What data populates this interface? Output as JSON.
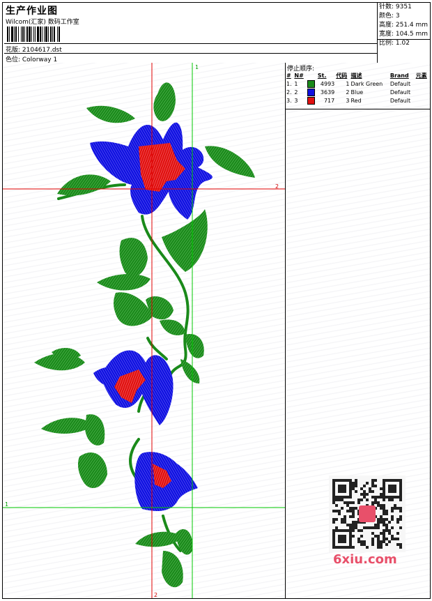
{
  "header": {
    "title": "生产作业图",
    "subtitle": "Wilcom(汇家) 数码工作室",
    "design_label": "花版: 2104617.dst",
    "colorway_label": "色位:  Colorway 1"
  },
  "stats": [
    "针数: 9351",
    "颜色: 3",
    "高度: 251.4 mm",
    "宽度: 104.5 mm",
    "比例: 1.02"
  ],
  "stop_sequence": {
    "title": "停止顺序:",
    "columns": [
      "#",
      "N#",
      "St.",
      "代码",
      "描述",
      "Brand",
      "元素"
    ],
    "rows": [
      {
        "idx": "1.",
        "n": "1",
        "color": "#1a8a1a",
        "st": "4993",
        "code": "1",
        "desc": "Dark Green",
        "brand": "Default"
      },
      {
        "idx": "2.",
        "n": "2",
        "color": "#1010e0",
        "st": "3639",
        "code": "2",
        "desc": "Blue",
        "brand": "Default"
      },
      {
        "idx": "3.",
        "n": "3",
        "color": "#e01010",
        "st": "717",
        "code": "3",
        "desc": "Red",
        "brand": "Default"
      }
    ]
  },
  "guides": {
    "v1": "1",
    "h2": "2",
    "h1": "1",
    "v2": "2"
  },
  "watermark": "6xiu.com",
  "colors": {
    "green": "#1a8a1a",
    "blue": "#1010e0",
    "red": "#e01010",
    "guide_red": "#e00000",
    "guide_green": "#00c800"
  }
}
